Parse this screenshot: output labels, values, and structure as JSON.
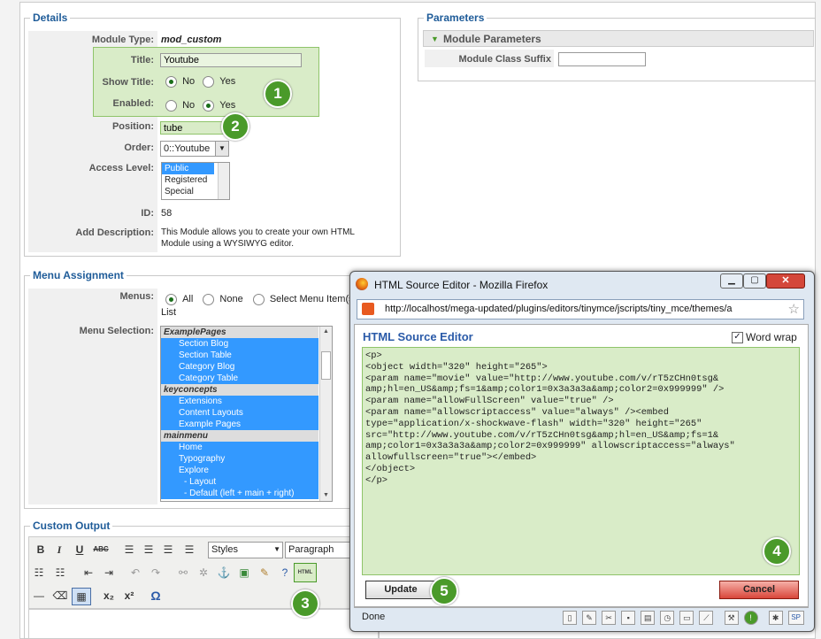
{
  "details": {
    "legend": "Details",
    "module_type_label": "Module Type:",
    "module_type_value": "mod_custom",
    "title_label": "Title:",
    "title_value": "Youtube",
    "show_title_label": "Show Title:",
    "enabled_label": "Enabled:",
    "no": "No",
    "yes": "Yes",
    "position_label": "Position:",
    "position_value": "tube",
    "order_label": "Order:",
    "order_value": "0::Youtube",
    "access_label": "Access Level:",
    "access_options": [
      "Public",
      "Registered",
      "Special"
    ],
    "id_label": "ID:",
    "id_value": "58",
    "desc_label": "Add Description:",
    "desc_line1": "This Module allows you to create your own HTML",
    "desc_line2": "Module using a WYSIWYG editor."
  },
  "parameters": {
    "legend": "Parameters",
    "header": "Module Parameters",
    "suffix_label": "Module Class Suffix"
  },
  "menu": {
    "legend": "Menu Assignment",
    "menus_label": "Menus:",
    "all": "All",
    "none": "None",
    "select": "Select Menu Item(s) fr",
    "list_word": "List",
    "selection_label": "Menu Selection:",
    "items": [
      {
        "t": "ExamplePages",
        "g": true
      },
      {
        "t": "Section Blog"
      },
      {
        "t": "Section Table"
      },
      {
        "t": "Category Blog"
      },
      {
        "t": "Category Table"
      },
      {
        "t": "keyconcepts",
        "g": true
      },
      {
        "t": "Extensions"
      },
      {
        "t": "Content Layouts"
      },
      {
        "t": "Example Pages"
      },
      {
        "t": "mainmenu",
        "g": true
      },
      {
        "t": "Home"
      },
      {
        "t": "Typography"
      },
      {
        "t": "Explore"
      },
      {
        "t": "- Layout"
      },
      {
        "t": "- Default (left + main + right)"
      }
    ]
  },
  "custom": {
    "legend": "Custom Output",
    "styles": "Styles",
    "paragraph": "Paragraph",
    "html_btn": "HTML"
  },
  "popup": {
    "title": "HTML Source Editor - Mozilla Firefox",
    "url": "http://localhost/mega-updated/plugins/editors/tinymce/jscripts/tiny_mce/themes/a",
    "heading": "HTML Source Editor",
    "wordwrap": "Word wrap",
    "source": "<p>\n<object width=\"320\" height=\"265\">\n<param name=\"movie\" value=\"http://www.youtube.com/v/rT5zCHn0tsg&\namp;hl=en_US&amp;fs=1&amp;color1=0x3a3a3a&amp;color2=0x999999\" />\n<param name=\"allowFullScreen\" value=\"true\" />\n<param name=\"allowscriptaccess\" value=\"always\" /><embed\ntype=\"application/x-shockwave-flash\" width=\"320\" height=\"265\"\nsrc=\"http://www.youtube.com/v/rT5zCHn0tsg&amp;hl=en_US&amp;fs=1&\namp;color1=0x3a3a3a&amp;color2=0x999999\" allowscriptaccess=\"always\"\nallowfullscreen=\"true\"></embed>\n</object>\n</p>",
    "update": "Update",
    "cancel": "Cancel",
    "status": "Done"
  },
  "badges": [
    "1",
    "2",
    "3",
    "4",
    "5"
  ],
  "colors": {
    "green": "#4a9a2a",
    "highlight": "#d9ecc8",
    "legend": "#1f5c99",
    "select": "#3399ff"
  }
}
